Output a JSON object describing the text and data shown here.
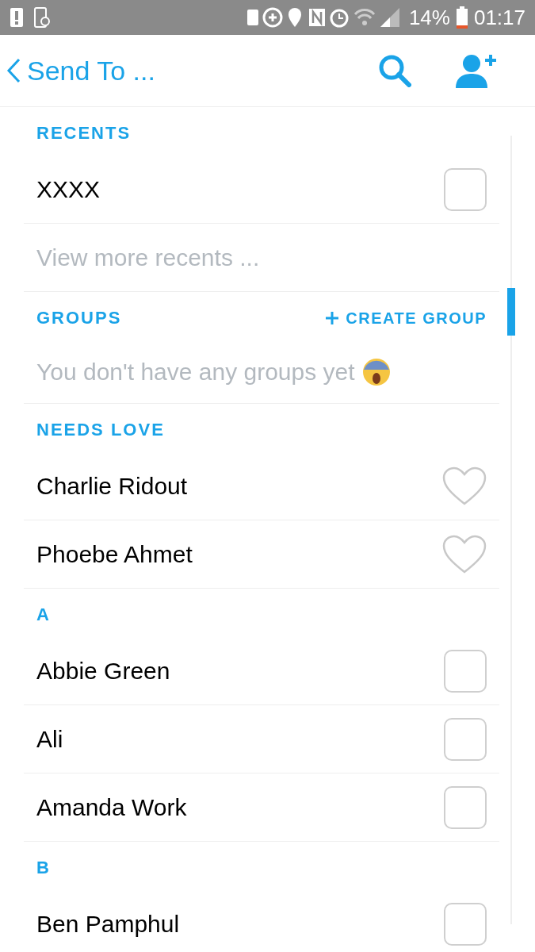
{
  "status_bar": {
    "battery": "14%",
    "time": "01:17"
  },
  "header": {
    "back": "Send To ..."
  },
  "sections": [
    {
      "title": "RECENTS",
      "rows": [
        {
          "kind": "contact",
          "name": "XXXX",
          "checked": false
        },
        {
          "kind": "more",
          "name": "View more recents ..."
        }
      ]
    },
    {
      "title": "GROUPS",
      "action": "CREATE GROUP",
      "rows": [
        {
          "kind": "empty",
          "name": "You don't have any groups yet"
        }
      ]
    },
    {
      "title": "NEEDS LOVE",
      "rows": [
        {
          "kind": "love",
          "name": "Charlie Ridout"
        },
        {
          "kind": "love",
          "name": "Phoebe Ahmet"
        }
      ]
    },
    {
      "title": "A",
      "rows": [
        {
          "kind": "contact",
          "name": "Abbie Green",
          "checked": false
        },
        {
          "kind": "contact",
          "name": "Ali",
          "checked": false
        },
        {
          "kind": "contact",
          "name": "Amanda Work",
          "checked": false
        }
      ]
    },
    {
      "title": "B",
      "rows": [
        {
          "kind": "contact",
          "name": "Ben Pamphul",
          "checked": false
        }
      ]
    }
  ]
}
